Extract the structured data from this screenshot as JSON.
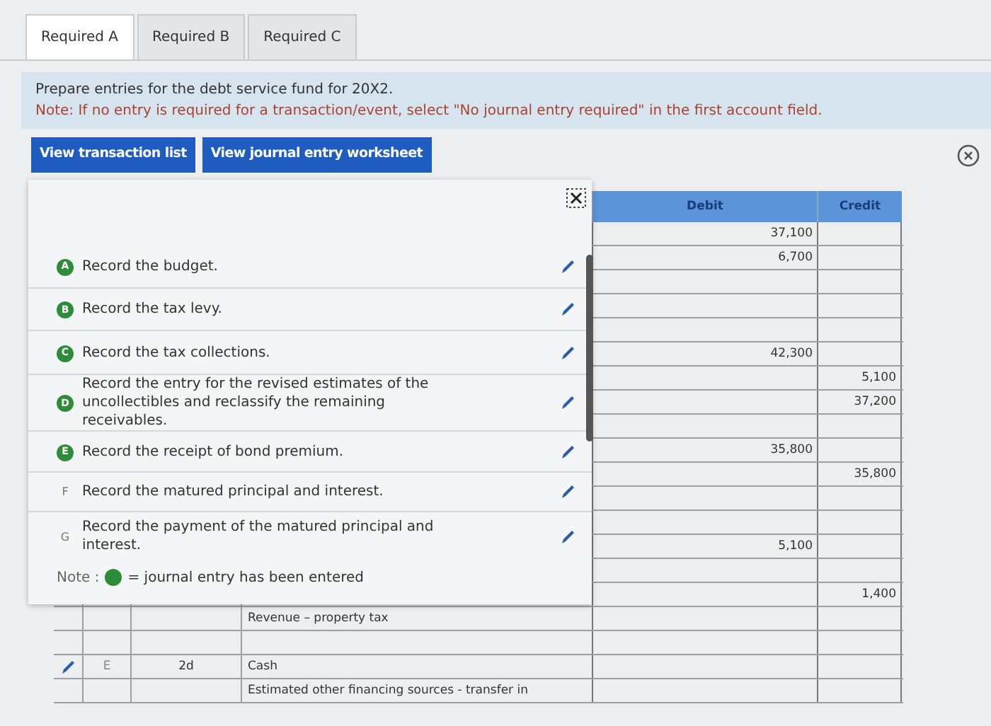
{
  "tabs": [
    {
      "label": "Required A",
      "selected": true
    },
    {
      "label": "Required B",
      "selected": false
    },
    {
      "label": "Required C",
      "selected": false
    }
  ],
  "instructions": {
    "text": "Prepare entries for the debt service fund for 20X2.",
    "note": "Note: If no entry is required for a transaction/event, select \"No journal entry required\" in the first account field."
  },
  "buttons": [
    "View transaction list",
    "View journal entry worksheet"
  ],
  "transaction_list": {
    "items": [
      {
        "letter": "A",
        "text": "Record the budget.",
        "entered": true
      },
      {
        "letter": "B",
        "text": "Record the tax levy.",
        "entered": true
      },
      {
        "letter": "C",
        "text": "Record the tax collections.",
        "entered": true
      },
      {
        "letter": "D",
        "text": "Record the entry for the revised estimates of the uncollectibles and reclassify the remaining receivables.",
        "entered": true
      },
      {
        "letter": "E",
        "text": "Record the receipt of bond premium.",
        "entered": true
      },
      {
        "letter": "F",
        "text": "Record the matured principal and interest.",
        "entered": false
      },
      {
        "letter": "G",
        "text": "Record the payment of the matured principal and interest.",
        "entered": false
      }
    ],
    "note_label": "Note :",
    "note_text": "= journal entry has been entered"
  },
  "table": {
    "columns": [
      "Debit",
      "Credit"
    ],
    "rows": [
      {
        "debit": "37,100"
      },
      {
        "debit": "6,700"
      },
      {},
      {},
      {},
      {
        "debit": "42,300"
      },
      {
        "credit": "5,100"
      },
      {
        "credit": "37,200"
      },
      {},
      {
        "debit": "35,800"
      },
      {
        "credit": "35,800"
      },
      {},
      {},
      {
        "debit": "5,100"
      },
      {},
      {
        "credit": "1,400"
      },
      {
        "account": "Revenue – property tax",
        "edit_icon": false
      },
      {
        "edit_icon": false
      },
      {
        "transaction": "E",
        "date": "2d",
        "account": "Cash",
        "edit_icon": true
      },
      {
        "account": "Estimated other financing sources - transfer in",
        "edit_icon": false
      }
    ]
  }
}
